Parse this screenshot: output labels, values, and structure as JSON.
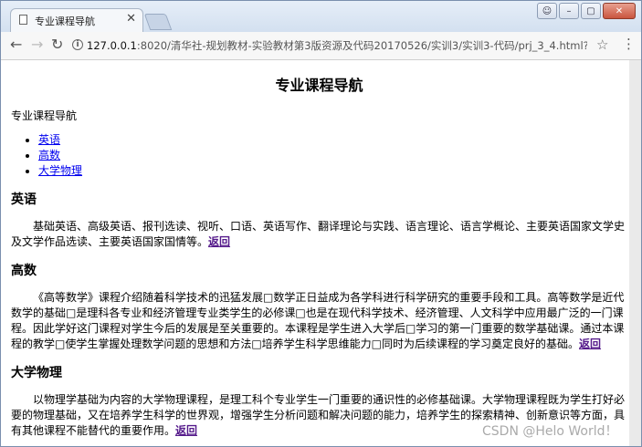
{
  "browser": {
    "tab_title": "专业课程导航",
    "close_symbol": "✕",
    "url_host": "127.0.0.1",
    "url_path": ":8020/清华社-规划教材-实验教材第3版资源及代码20170526/实训3/实训3-代码/prj_3_4.html?__hbt=15018..."
  },
  "page": {
    "title": "专业课程导航",
    "intro": "专业课程导航",
    "nav_items": [
      {
        "label": "英语"
      },
      {
        "label": "高数"
      },
      {
        "label": "大学物理"
      }
    ],
    "back_label": "返回",
    "sections": [
      {
        "heading": "英语",
        "text": "基础英语、高级英语、报刊选读、视听、口语、英语写作、翻译理论与实践、语言理论、语言学概论、主要英语国家文学史及文学作品选读、主要英语国家国情等。"
      },
      {
        "heading": "高数",
        "text": "《高等数学》课程介绍随着科学技术的迅猛发展□数学正日益成为各学科进行科学研究的重要手段和工具。高等数学是近代数学的基础□是理科各专业和经济管理专业类学生的必修课□也是在现代科学技术、经济管理、人文科学中应用最广泛的一门课程。因此学好这门课程对学生今后的发展是至关重要的。本课程是学生进入大学后□学习的第一门重要的数学基础课。通过本课程的教学□使学生掌握处理数学问题的思想和方法□培养学生科学思维能力□同时为后续课程的学习奠定良好的基础。"
      },
      {
        "heading": "大学物理",
        "text": "以物理学基础为内容的大学物理课程，是理工科个专业学生一门重要的通识性的必修基础课。大学物理课程既为学生打好必要的物理基础，又在培养学生科学的世界观，增强学生分析问题和解决问题的能力，培养学生的探索精神、创新意识等方面，具有其他课程不能替代的重要作用。"
      }
    ]
  },
  "watermark": "CSDN @Helo World！"
}
